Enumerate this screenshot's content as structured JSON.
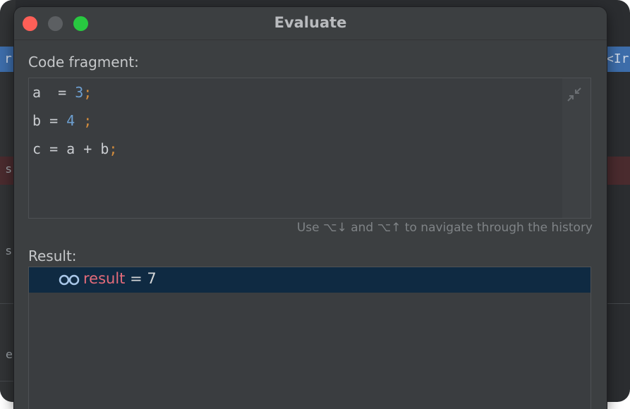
{
  "dialog": {
    "title": "Evaluate",
    "code_fragment_label": "Code fragment:",
    "code_lines": [
      {
        "a": "a",
        "op": "  = ",
        "num": "3",
        "semi": ";"
      },
      {
        "a": "b",
        "op": " = ",
        "num": "4",
        "semi": " ;"
      },
      {
        "expr": "c = a + b",
        "semi": ";"
      }
    ],
    "history_hint": "Use ⌥↓ and ⌥↑ to navigate through the history",
    "result_label": "Result:",
    "result": {
      "name": "result",
      "equals": " = ",
      "value": "7"
    }
  },
  "background": {
    "left_tab_text": "r",
    "right_tab_text": "<Ir",
    "left_glyphs": [
      "s",
      "s",
      "e"
    ]
  },
  "colors": {
    "close": "#fe5f57",
    "minimize": "#5c5f62",
    "maximize": "#28c840",
    "result_highlight": "#0f2a42",
    "number": "#6d9fd0",
    "semicolon": "#d28c3d",
    "result_name": "#e46b7a"
  },
  "icons": [
    "collapse-icon",
    "watch-glasses-icon"
  ]
}
